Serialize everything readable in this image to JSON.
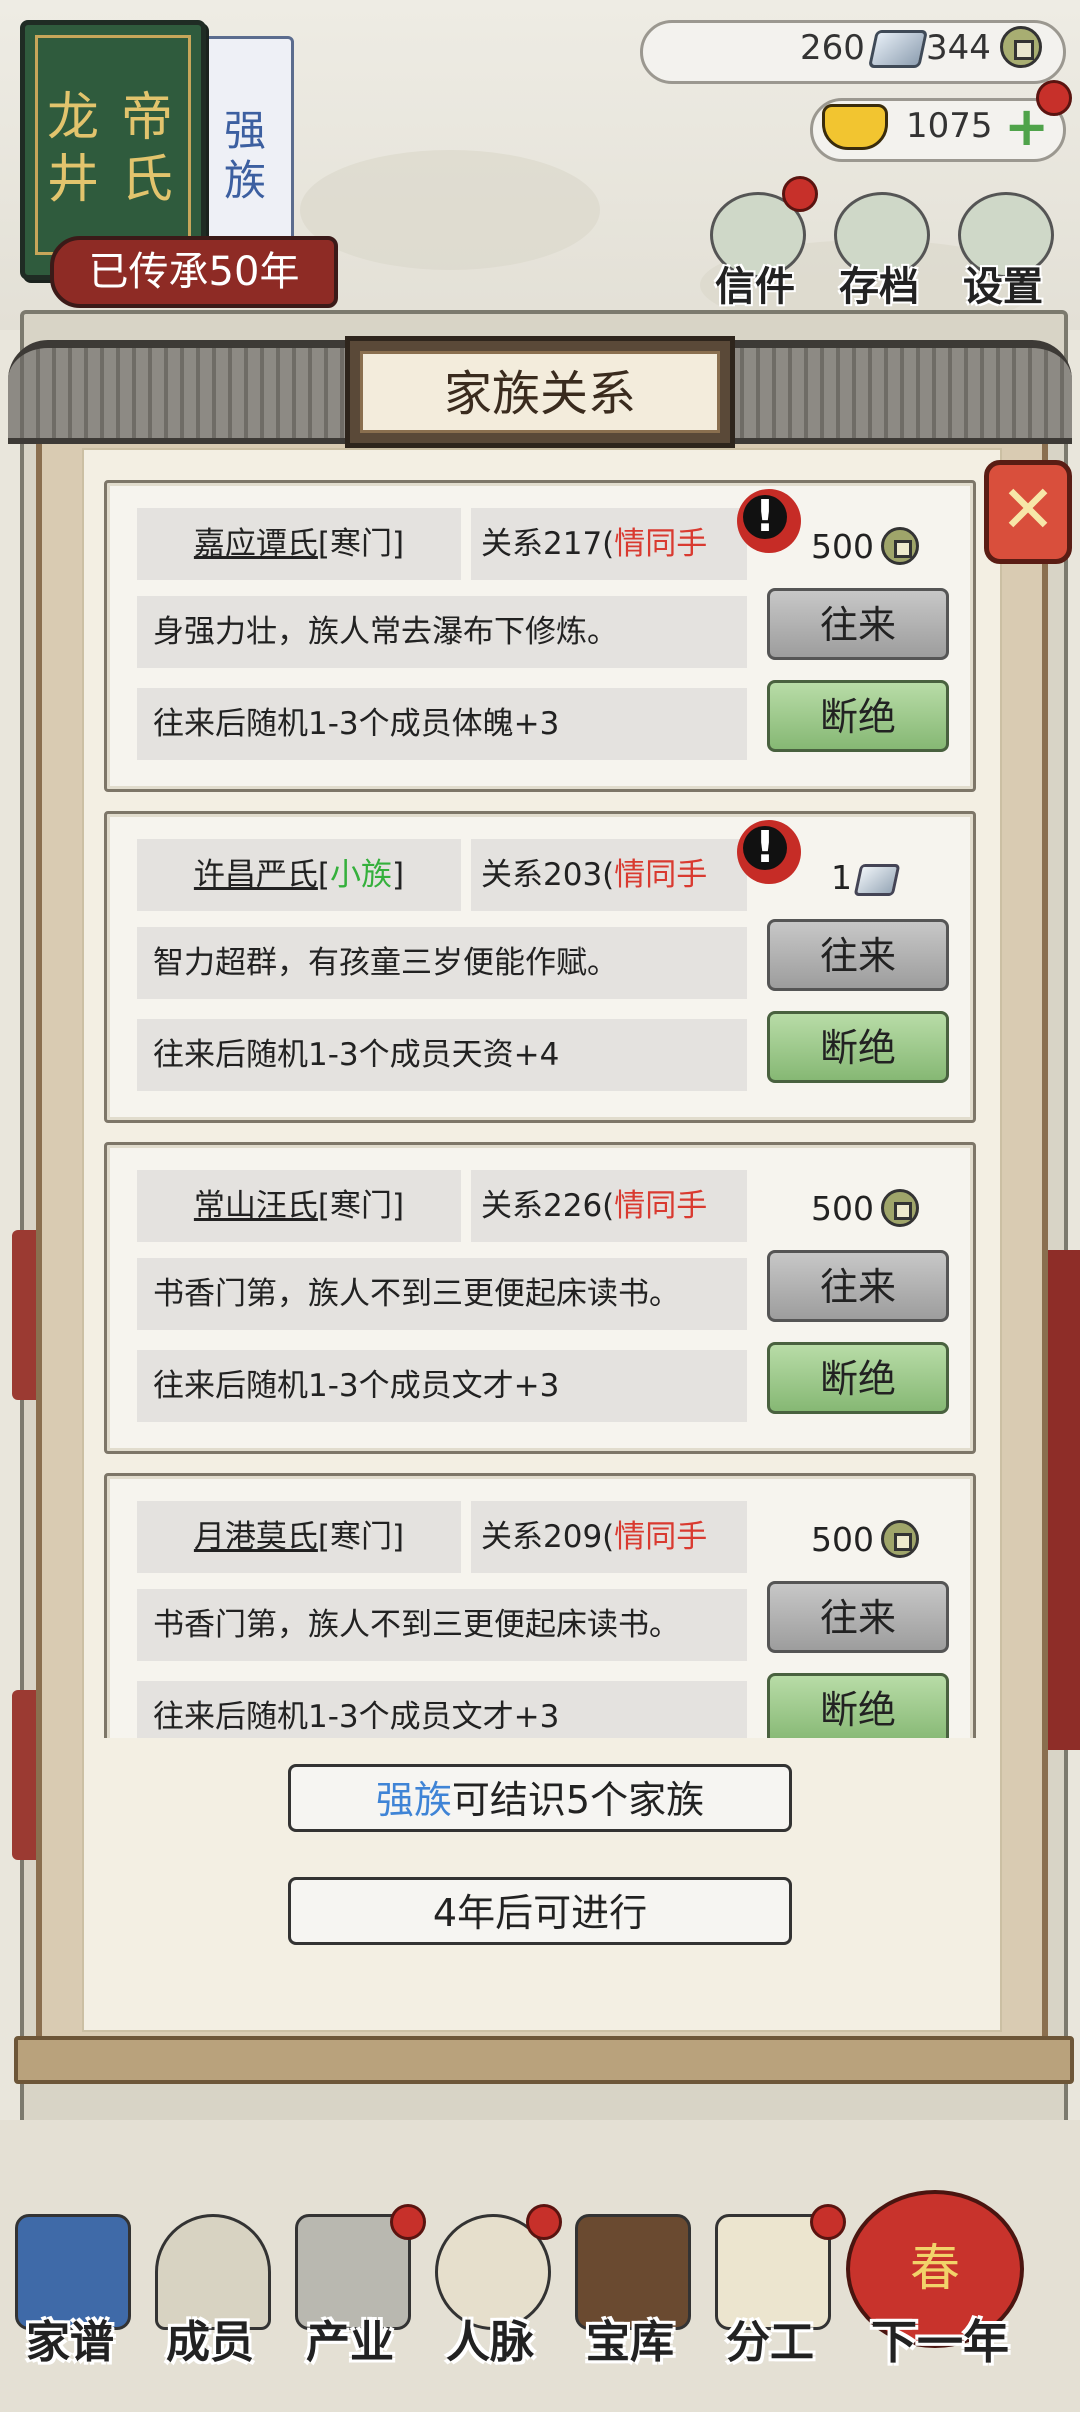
{
  "family": {
    "name_chars": [
      "龙",
      "井",
      "帝",
      "氏"
    ],
    "tier_chars": [
      "强",
      "族"
    ],
    "heritage": "已传承50年"
  },
  "resources": {
    "silver": "260",
    "coins": "344",
    "gold": "1075"
  },
  "top_buttons": [
    {
      "label": "信件",
      "icon": "letter-icon"
    },
    {
      "label": "存档",
      "icon": "save-scroll-icon"
    },
    {
      "label": "设置",
      "icon": "gear-icon"
    }
  ],
  "dialog": {
    "title": "家族关系",
    "clans": [
      {
        "name": "嘉应谭氏",
        "rank": "寒门",
        "rank_color": "#222222",
        "relation_prefix": "关系217(",
        "relation_status": "情同手足",
        "relation_suffix": ")",
        "alert": true,
        "cost": "500",
        "cost_icon": "coin-icon",
        "desc": "身强力壮，族人常去瀑布下修炼。",
        "bonus": "往来后随机1-3个成员体魄+3",
        "interact": "往来",
        "sever": "断绝"
      },
      {
        "name": "许昌严氏",
        "rank": "小族",
        "rank_color": "#35b03c",
        "relation_prefix": "关系203(",
        "relation_status": "情同手足",
        "relation_suffix": ")",
        "alert": true,
        "cost": "1",
        "cost_icon": "silver-ingot-icon",
        "desc": "智力超群，有孩童三岁便能作赋。",
        "bonus": "往来后随机1-3个成员天资+4",
        "interact": "往来",
        "sever": "断绝"
      },
      {
        "name": "常山汪氏",
        "rank": "寒门",
        "rank_color": "#222222",
        "relation_prefix": "关系226(",
        "relation_status": "情同手足",
        "relation_suffix": ")",
        "alert": false,
        "cost": "500",
        "cost_icon": "coin-icon",
        "desc": "书香门第，族人不到三更便起床读书。",
        "bonus": "往来后随机1-3个成员文才+3",
        "interact": "往来",
        "sever": "断绝"
      },
      {
        "name": "月港莫氏",
        "rank": "寒门",
        "rank_color": "#222222",
        "relation_prefix": "关系209(",
        "relation_status": "情同手足",
        "relation_suffix": ")",
        "alert": false,
        "cost": "500",
        "cost_icon": "coin-icon",
        "desc": "书香门第，族人不到三更便起床读书。",
        "bonus": "往来后随机1-3个成员文才+3",
        "interact": "往来",
        "sever": "断绝"
      }
    ],
    "limit_highlight": "强族",
    "limit_rest": "可结识5个家族",
    "cooldown": "4年后可进行"
  },
  "nav": [
    {
      "label": "家谱",
      "icon": "genealogy-book-icon"
    },
    {
      "label": "成员",
      "icon": "member-icon"
    },
    {
      "label": "产业",
      "icon": "industry-building-icon"
    },
    {
      "label": "人脉",
      "icon": "network-icon"
    },
    {
      "label": "宝库",
      "icon": "treasury-chest-icon"
    },
    {
      "label": "分工",
      "icon": "division-scroll-icon"
    },
    {
      "label": "下一年",
      "icon": "lantern-icon"
    }
  ],
  "next_year_char": "春",
  "colors": {
    "relation_status": "#d93a30",
    "small_clan": "#35b03c",
    "tier_highlight": "#3f84d6"
  }
}
